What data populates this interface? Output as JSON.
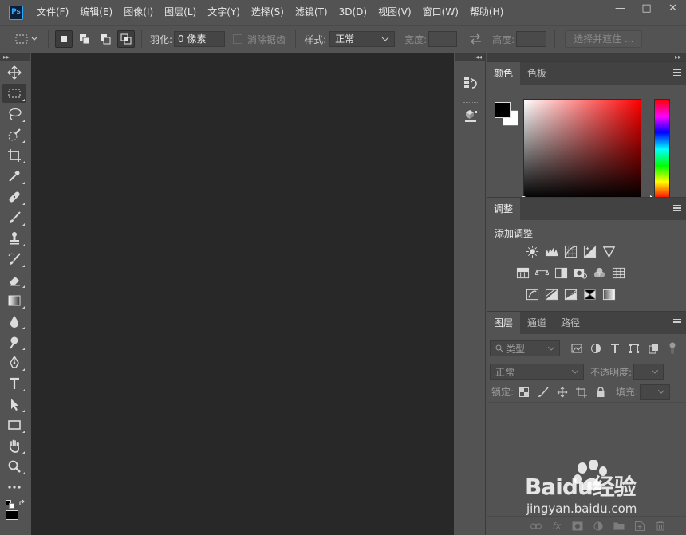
{
  "app": {
    "logo": "Ps"
  },
  "menu": [
    "文件(F)",
    "编辑(E)",
    "图像(I)",
    "图层(L)",
    "文字(Y)",
    "选择(S)",
    "滤镜(T)",
    "3D(D)",
    "视图(V)",
    "窗口(W)",
    "帮助(H)"
  ],
  "window_controls": {
    "minimize": "—",
    "maximize": "□",
    "close": "✕"
  },
  "options": {
    "feather_label": "羽化:",
    "feather_value": "0 像素",
    "antialias_label": "消除锯齿",
    "style_label": "样式:",
    "style_value": "正常",
    "width_label": "宽度:",
    "height_label": "高度:",
    "select_mask_button": "选择并遮住 ..."
  },
  "tools": [
    "move",
    "rect-marquee",
    "lasso",
    "quick-select",
    "crop",
    "eyedropper",
    "healing-brush",
    "brush",
    "clone-stamp",
    "history-brush",
    "eraser",
    "gradient",
    "blur",
    "dodge",
    "pen",
    "type",
    "path-select",
    "rectangle",
    "hand",
    "zoom",
    "more"
  ],
  "color_panel": {
    "tabs": [
      "颜色",
      "色板"
    ],
    "foreground": "#000000",
    "background": "#ffffff"
  },
  "adjust_panel": {
    "tabs": [
      "调整"
    ],
    "add_label": "添加调整"
  },
  "layers_panel": {
    "tabs": [
      "图层",
      "通道",
      "路径"
    ],
    "filter_type": "类型",
    "blend_mode": "正常",
    "opacity_label": "不透明度:",
    "lock_label": "锁定:",
    "fill_label": "填充:"
  },
  "watermark": {
    "brand": "Baidu经验",
    "site": "jingyan.baidu.com"
  }
}
